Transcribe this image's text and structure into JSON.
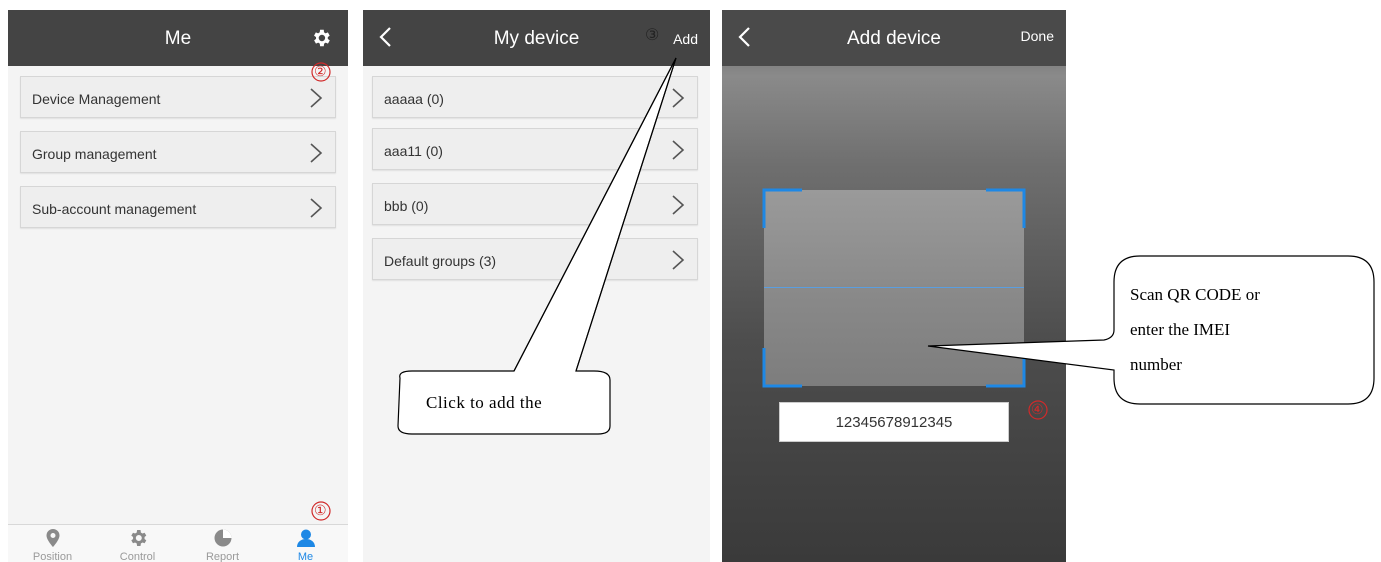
{
  "screen_me": {
    "title": "Me",
    "menu": [
      {
        "label": "Device Management"
      },
      {
        "label": "Group management"
      },
      {
        "label": "Sub-account management"
      }
    ],
    "tabs": [
      {
        "label": "Position",
        "icon": "position-icon"
      },
      {
        "label": "Control",
        "icon": "control-icon"
      },
      {
        "label": "Report",
        "icon": "report-icon"
      },
      {
        "label": "Me",
        "icon": "me-icon",
        "active": true
      }
    ]
  },
  "screen_my_device": {
    "title": "My device",
    "add_label": "Add",
    "groups": [
      {
        "label": "aaaaa (0)"
      },
      {
        "label": "aaa11 (0)"
      },
      {
        "label": "bbb (0)"
      },
      {
        "label": "Default groups (3)"
      }
    ]
  },
  "screen_add_device": {
    "title": "Add device",
    "done_label": "Done",
    "imei_value": "12345678912345"
  },
  "annotations": {
    "step1": "①",
    "step2": "②",
    "step3": "③",
    "step4": "④",
    "callout_add": "Click to add the",
    "callout_scan_line1": "Scan QR CODE or",
    "callout_scan_line2": "enter the IMEI",
    "callout_scan_line3": "number"
  },
  "colors": {
    "header": "#444444",
    "accent_blue": "#1e88e5",
    "annotation_red": "#d12a2a"
  }
}
